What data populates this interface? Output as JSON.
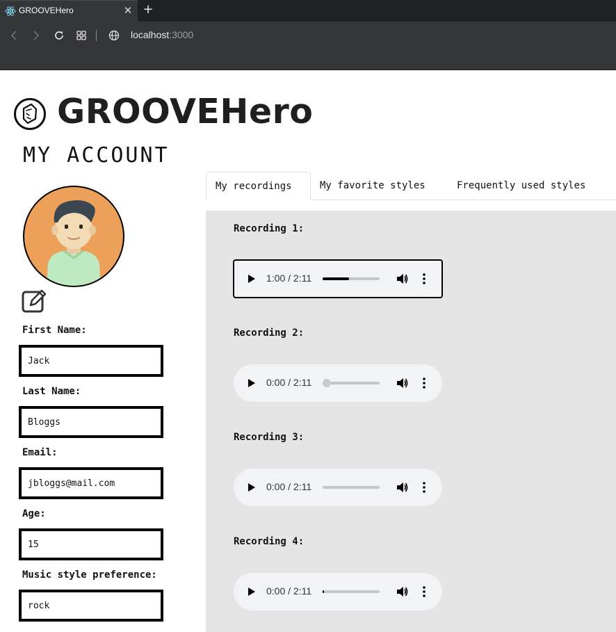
{
  "browser": {
    "tab_title": "GROOVEHero",
    "tab_close": "✕",
    "new_tab": "+",
    "url_host": "localhost",
    "url_port": ":3000"
  },
  "brand": {
    "name": "GROOVEHero"
  },
  "page_title": "MY ACCOUNT",
  "profile": {
    "fields": [
      {
        "label": "First Name:",
        "value": "Jack"
      },
      {
        "label": "Last Name:",
        "value": "Bloggs"
      },
      {
        "label": "Email:",
        "value": "jbloggs@mail.com"
      },
      {
        "label": "Age:",
        "value": "15"
      },
      {
        "label": "Music style preference:",
        "value": "rock"
      }
    ]
  },
  "tabs": [
    {
      "label": "My recordings",
      "active": true
    },
    {
      "label": "My favorite styles",
      "active": false
    },
    {
      "label": "Frequently used styles",
      "active": false
    }
  ],
  "recordings": [
    {
      "label": "Recording 1:",
      "time": "1:00 / 2:11",
      "progress": 0.46,
      "focused": true
    },
    {
      "label": "Recording 2:",
      "time": "0:00 / 2:11",
      "progress": 0.0,
      "focused": false,
      "thumb": true
    },
    {
      "label": "Recording 3:",
      "time": "0:00 / 2:11",
      "progress": 0.0,
      "focused": false
    },
    {
      "label": "Recording 4:",
      "time": "0:00 / 2:11",
      "progress": 0.03,
      "focused": false
    }
  ],
  "colors": {
    "panel_bg": "#e5e5e5",
    "player_bg": "#f1f3f4",
    "avatar_bg": "#eda05a",
    "avatar_shirt": "#bfe9c1"
  }
}
